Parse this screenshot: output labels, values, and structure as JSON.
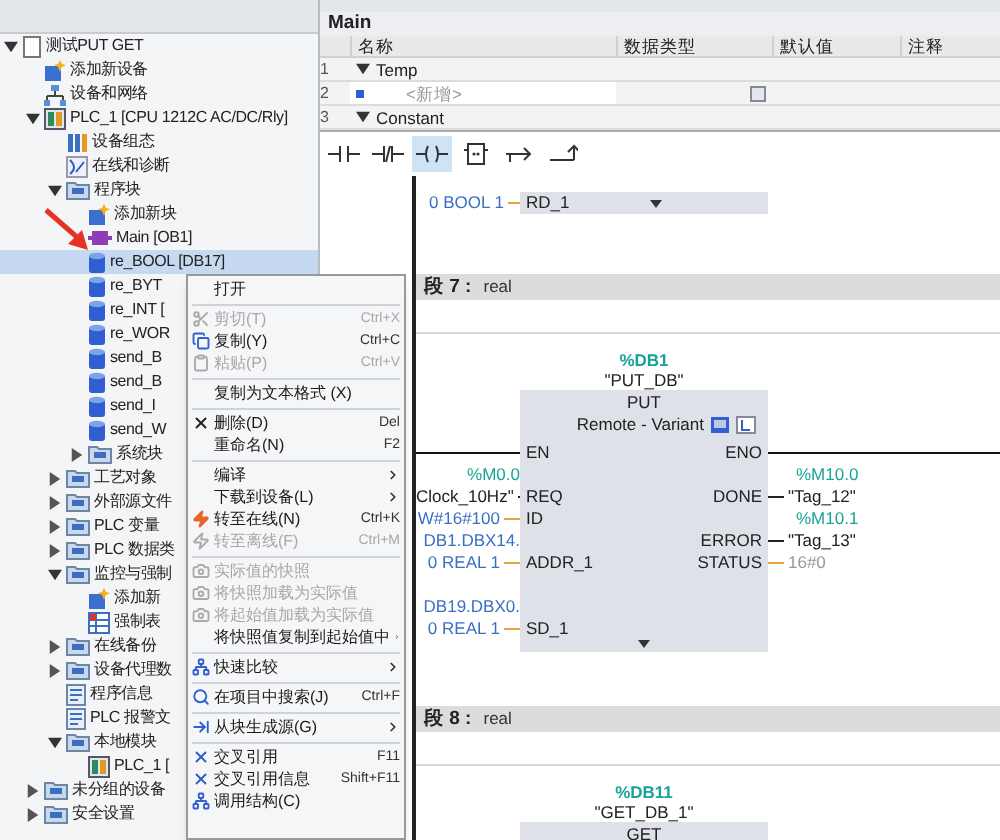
{
  "tree": {
    "items": [
      {
        "label": "测试PUT GET",
        "kind": "project",
        "expanded": true,
        "selected": false,
        "children": [
          {
            "label": "添加新设备",
            "kind": "add",
            "selected": false
          },
          {
            "label": "设备和网络",
            "kind": "network",
            "selected": false
          },
          {
            "label": "PLC_1 [CPU 1212C AC/DC/Rly]",
            "kind": "plc",
            "expanded": true,
            "selected": false,
            "children": [
              {
                "label": "设备组态",
                "kind": "config",
                "selected": false
              },
              {
                "label": "在线和诊断",
                "kind": "diag",
                "selected": false
              },
              {
                "label": "程序块",
                "kind": "folder",
                "expanded": true,
                "selected": false,
                "children": [
                  {
                    "label": "添加新块",
                    "kind": "add",
                    "selected": false
                  },
                  {
                    "label": "Main [OB1]",
                    "kind": "ob",
                    "selected": false
                  },
                  {
                    "label": "re_BOOL [DB17]",
                    "kind": "db",
                    "selected": true
                  },
                  {
                    "label": "re_BYT",
                    "kind": "db",
                    "selected": false
                  },
                  {
                    "label": "re_INT [",
                    "kind": "db",
                    "selected": false
                  },
                  {
                    "label": "re_WOR",
                    "kind": "db",
                    "selected": false
                  },
                  {
                    "label": "send_B",
                    "kind": "db",
                    "selected": false
                  },
                  {
                    "label": "send_B",
                    "kind": "db",
                    "selected": false
                  },
                  {
                    "label": "send_I",
                    "kind": "db",
                    "selected": false
                  },
                  {
                    "label": "send_W",
                    "kind": "db",
                    "selected": false
                  },
                  {
                    "label": "系统块",
                    "kind": "folder",
                    "expanded": false,
                    "selected": false
                  }
                ]
              },
              {
                "label": "工艺对象",
                "kind": "folder",
                "expanded": false,
                "selected": false
              },
              {
                "label": "外部源文件",
                "kind": "folder",
                "expanded": false,
                "selected": false
              },
              {
                "label": "PLC 变量",
                "kind": "folder",
                "expanded": false,
                "selected": false
              },
              {
                "label": "PLC 数据类",
                "kind": "folder",
                "expanded": false,
                "selected": false
              },
              {
                "label": "监控与强制",
                "kind": "folder",
                "expanded": true,
                "selected": false,
                "children": [
                  {
                    "label": "添加新",
                    "kind": "add",
                    "selected": false
                  },
                  {
                    "label": "强制表",
                    "kind": "table",
                    "selected": false
                  }
                ]
              },
              {
                "label": "在线备份",
                "kind": "folder",
                "expanded": false,
                "selected": false
              },
              {
                "label": "设备代理数",
                "kind": "folder",
                "expanded": false,
                "selected": false
              },
              {
                "label": "程序信息",
                "kind": "info",
                "selected": false
              },
              {
                "label": "PLC 报警文",
                "kind": "info",
                "selected": false
              },
              {
                "label": "本地模块",
                "kind": "folder",
                "expanded": true,
                "selected": false,
                "children": [
                  {
                    "label": "PLC_1 [",
                    "kind": "plc",
                    "selected": false
                  }
                ]
              }
            ]
          },
          {
            "label": "未分组的设备",
            "kind": "folder",
            "expanded": false,
            "selected": false
          },
          {
            "label": "安全设置",
            "kind": "folder",
            "expanded": false,
            "selected": false
          }
        ]
      }
    ]
  },
  "context_menu": {
    "items": [
      {
        "kind": "plain",
        "label": "打开",
        "disabled": false
      },
      {
        "kind": "separator"
      },
      {
        "kind": "cut",
        "label": "剪切(T)",
        "shortcut": "Ctrl+X",
        "disabled": true
      },
      {
        "kind": "copy",
        "label": "复制(Y)",
        "shortcut": "Ctrl+C",
        "disabled": false
      },
      {
        "kind": "paste",
        "label": "粘贴(P)",
        "shortcut": "Ctrl+V",
        "disabled": true
      },
      {
        "kind": "separator"
      },
      {
        "kind": "plain",
        "label": "复制为文本格式 (X)",
        "disabled": false
      },
      {
        "kind": "separator"
      },
      {
        "kind": "delete",
        "label": "删除(D)",
        "shortcut": "Del",
        "disabled": false
      },
      {
        "kind": "plain",
        "label": "重命名(N)",
        "shortcut": "F2",
        "disabled": false
      },
      {
        "kind": "separator"
      },
      {
        "kind": "plain",
        "label": "编译",
        "submenu": true,
        "disabled": false
      },
      {
        "kind": "plain",
        "label": "下载到设备(L)",
        "submenu": true,
        "disabled": false
      },
      {
        "kind": "online",
        "label": "转至在线(N)",
        "shortcut": "Ctrl+K",
        "disabled": false
      },
      {
        "kind": "offline",
        "label": "转至离线(F)",
        "shortcut": "Ctrl+M",
        "disabled": true
      },
      {
        "kind": "separator"
      },
      {
        "kind": "snapshot",
        "label": "实际值的快照",
        "disabled": true
      },
      {
        "kind": "snapshot",
        "label": "将快照加载为实际值",
        "disabled": true
      },
      {
        "kind": "snapshot",
        "label": "将起始值加载为实际值",
        "disabled": true
      },
      {
        "kind": "plain",
        "label": "将快照值复制到起始值中",
        "submenu": true,
        "disabled": false
      },
      {
        "kind": "separator"
      },
      {
        "kind": "compare",
        "label": "快速比较",
        "submenu": true,
        "disabled": false
      },
      {
        "kind": "separator"
      },
      {
        "kind": "search",
        "label": "在项目中搜索(J)",
        "shortcut": "Ctrl+F",
        "disabled": false
      },
      {
        "kind": "separator"
      },
      {
        "kind": "source",
        "label": "从块生成源(G)",
        "submenu": true,
        "disabled": false
      },
      {
        "kind": "separator"
      },
      {
        "kind": "crossref",
        "label": "交叉引用",
        "shortcut": "F11",
        "disabled": false
      },
      {
        "kind": "crossref",
        "label": "交叉引用信息",
        "shortcut": "Shift+F11",
        "disabled": false
      },
      {
        "kind": "callstruct",
        "label": "调用结构(C)",
        "disabled": false
      }
    ]
  },
  "editor": {
    "title": "Main",
    "interface_table": {
      "columns": [
        "名称",
        "数据类型",
        "默认值",
        "注释"
      ],
      "rows": [
        {
          "number": "1",
          "kind": "section",
          "expanded": true,
          "name": "Temp"
        },
        {
          "number": "2",
          "kind": "add",
          "name": "<新增>"
        },
        {
          "number": "3",
          "kind": "section",
          "expanded": true,
          "name": "Constant"
        }
      ]
    },
    "lad_toolbar": [
      {
        "kind": "no-contact",
        "selected": false
      },
      {
        "kind": "nc-contact",
        "selected": false
      },
      {
        "kind": "coil",
        "selected": true
      },
      {
        "kind": "empty-box",
        "selected": false
      },
      {
        "kind": "open-branch",
        "selected": false
      },
      {
        "kind": "close-branch",
        "selected": false
      }
    ],
    "previous_block": {
      "operand": "0 BOOL 1",
      "pin": "RD_1"
    },
    "networks": [
      {
        "title": "段 7 :",
        "comment": "real",
        "block": {
          "instance_address": "%DB1",
          "instance_name": "\"PUT_DB\"",
          "name": "PUT",
          "subtitle": "Remote - Variant",
          "rows": [
            {
              "in": {
                "kind": "power",
                "pin": "EN"
              },
              "out": {
                "kind": "power",
                "pin": "ENO"
              }
            },
            {
              "in": {
                "kind": "address",
                "text": "%M0.0"
              },
              "out": {
                "kind": "address",
                "text": "%M10.0"
              }
            },
            {
              "in": {
                "kind": "tag",
                "text": "Clock_10Hz\"",
                "pin": "REQ"
              },
              "out": {
                "kind": "tag",
                "text": "\"Tag_12\"",
                "pin": "DONE"
              }
            },
            {
              "in": {
                "kind": "constant",
                "text": "W#16#100",
                "pin": "ID"
              },
              "out": {
                "kind": "address",
                "text": "%M10.1"
              }
            },
            {
              "in": {
                "kind": "pointer",
                "text": "DB1.DBX14."
              },
              "out": {
                "kind": "tag",
                "text": "\"Tag_13\"",
                "pin": "ERROR"
              }
            },
            {
              "in": {
                "kind": "constant",
                "text": "0 REAL 1",
                "pin": "ADDR_1"
              },
              "out": {
                "kind": "value",
                "text": "16#0",
                "pin": "STATUS"
              }
            },
            {},
            {
              "in": {
                "kind": "pointer",
                "text": "DB19.DBX0."
              }
            },
            {
              "in": {
                "kind": "constant",
                "text": "0 REAL 1",
                "pin": "SD_1"
              }
            }
          ]
        }
      },
      {
        "title": "段 8 :",
        "comment": "real",
        "block": {
          "instance_address": "%DB11",
          "instance_name": "\"GET_DB_1\"",
          "name": "GET"
        }
      }
    ]
  }
}
